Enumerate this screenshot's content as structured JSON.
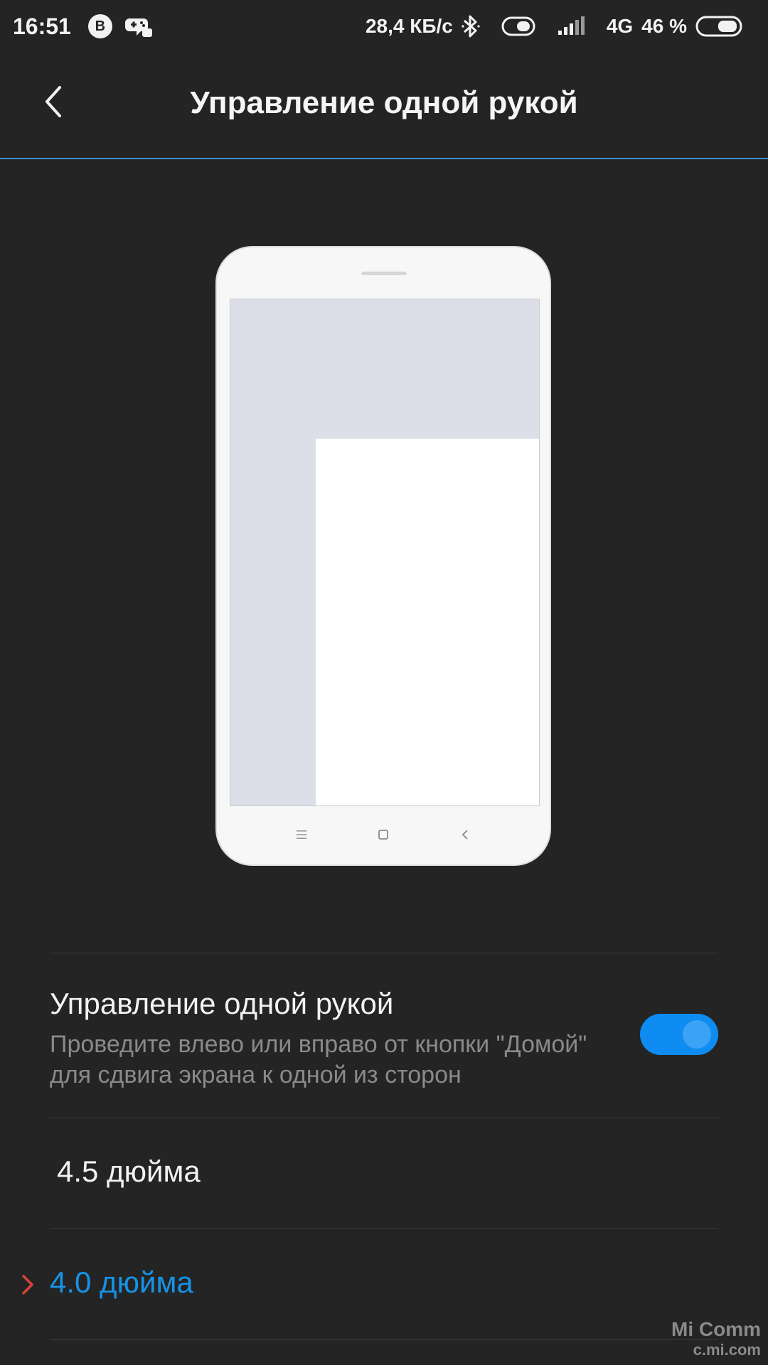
{
  "status_bar": {
    "time": "16:51",
    "vk_badge": "B",
    "notification_icons": [
      "vk-icon",
      "gamepad-icon"
    ],
    "speed": "28,4 КБ/с",
    "network": "4G",
    "battery_pct": "46 %"
  },
  "header": {
    "title": "Управление одной рукой",
    "back_icon": "chevron-left-icon"
  },
  "illustration": {
    "nav_icons": [
      "menu-icon",
      "home-icon",
      "back-icon"
    ]
  },
  "setting": {
    "title": "Управление одной рукой",
    "description": "Проведите влево или вправо от кнопки \"Домой\" для сдвига экрана к одной из сторон",
    "enabled": true
  },
  "size_options": [
    {
      "label": "4.5 дюйма",
      "selected": false
    },
    {
      "label": "4.0 дюйма",
      "selected": true
    }
  ],
  "watermark": {
    "line1": "Mi Comm",
    "line2": "c.mi.com"
  },
  "colors": {
    "background": "#242424",
    "accent": "#1793e6",
    "toggle_on": "#0e8cf2",
    "selected_marker": "#d9413a"
  }
}
